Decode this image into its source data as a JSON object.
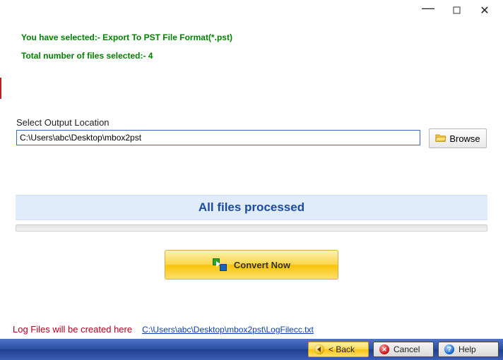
{
  "titlebar": {},
  "info": {
    "selected_line": "You have selected:- Export To PST File Format(*.pst)",
    "count_line": "Total number of files selected:- 4"
  },
  "output": {
    "label": "Select Output Location",
    "path": "C:\\Users\\abc\\Desktop\\mbox2pst",
    "browse_label": "Browse"
  },
  "status": {
    "text": "All files processed"
  },
  "convert": {
    "label": "Convert Now"
  },
  "log": {
    "label": "Log Files will be created here",
    "link": "C:\\Users\\abc\\Desktop\\mbox2pst\\LogFilecc.txt"
  },
  "buttons": {
    "back": "< Back",
    "cancel": "Cancel",
    "help": "Help"
  }
}
